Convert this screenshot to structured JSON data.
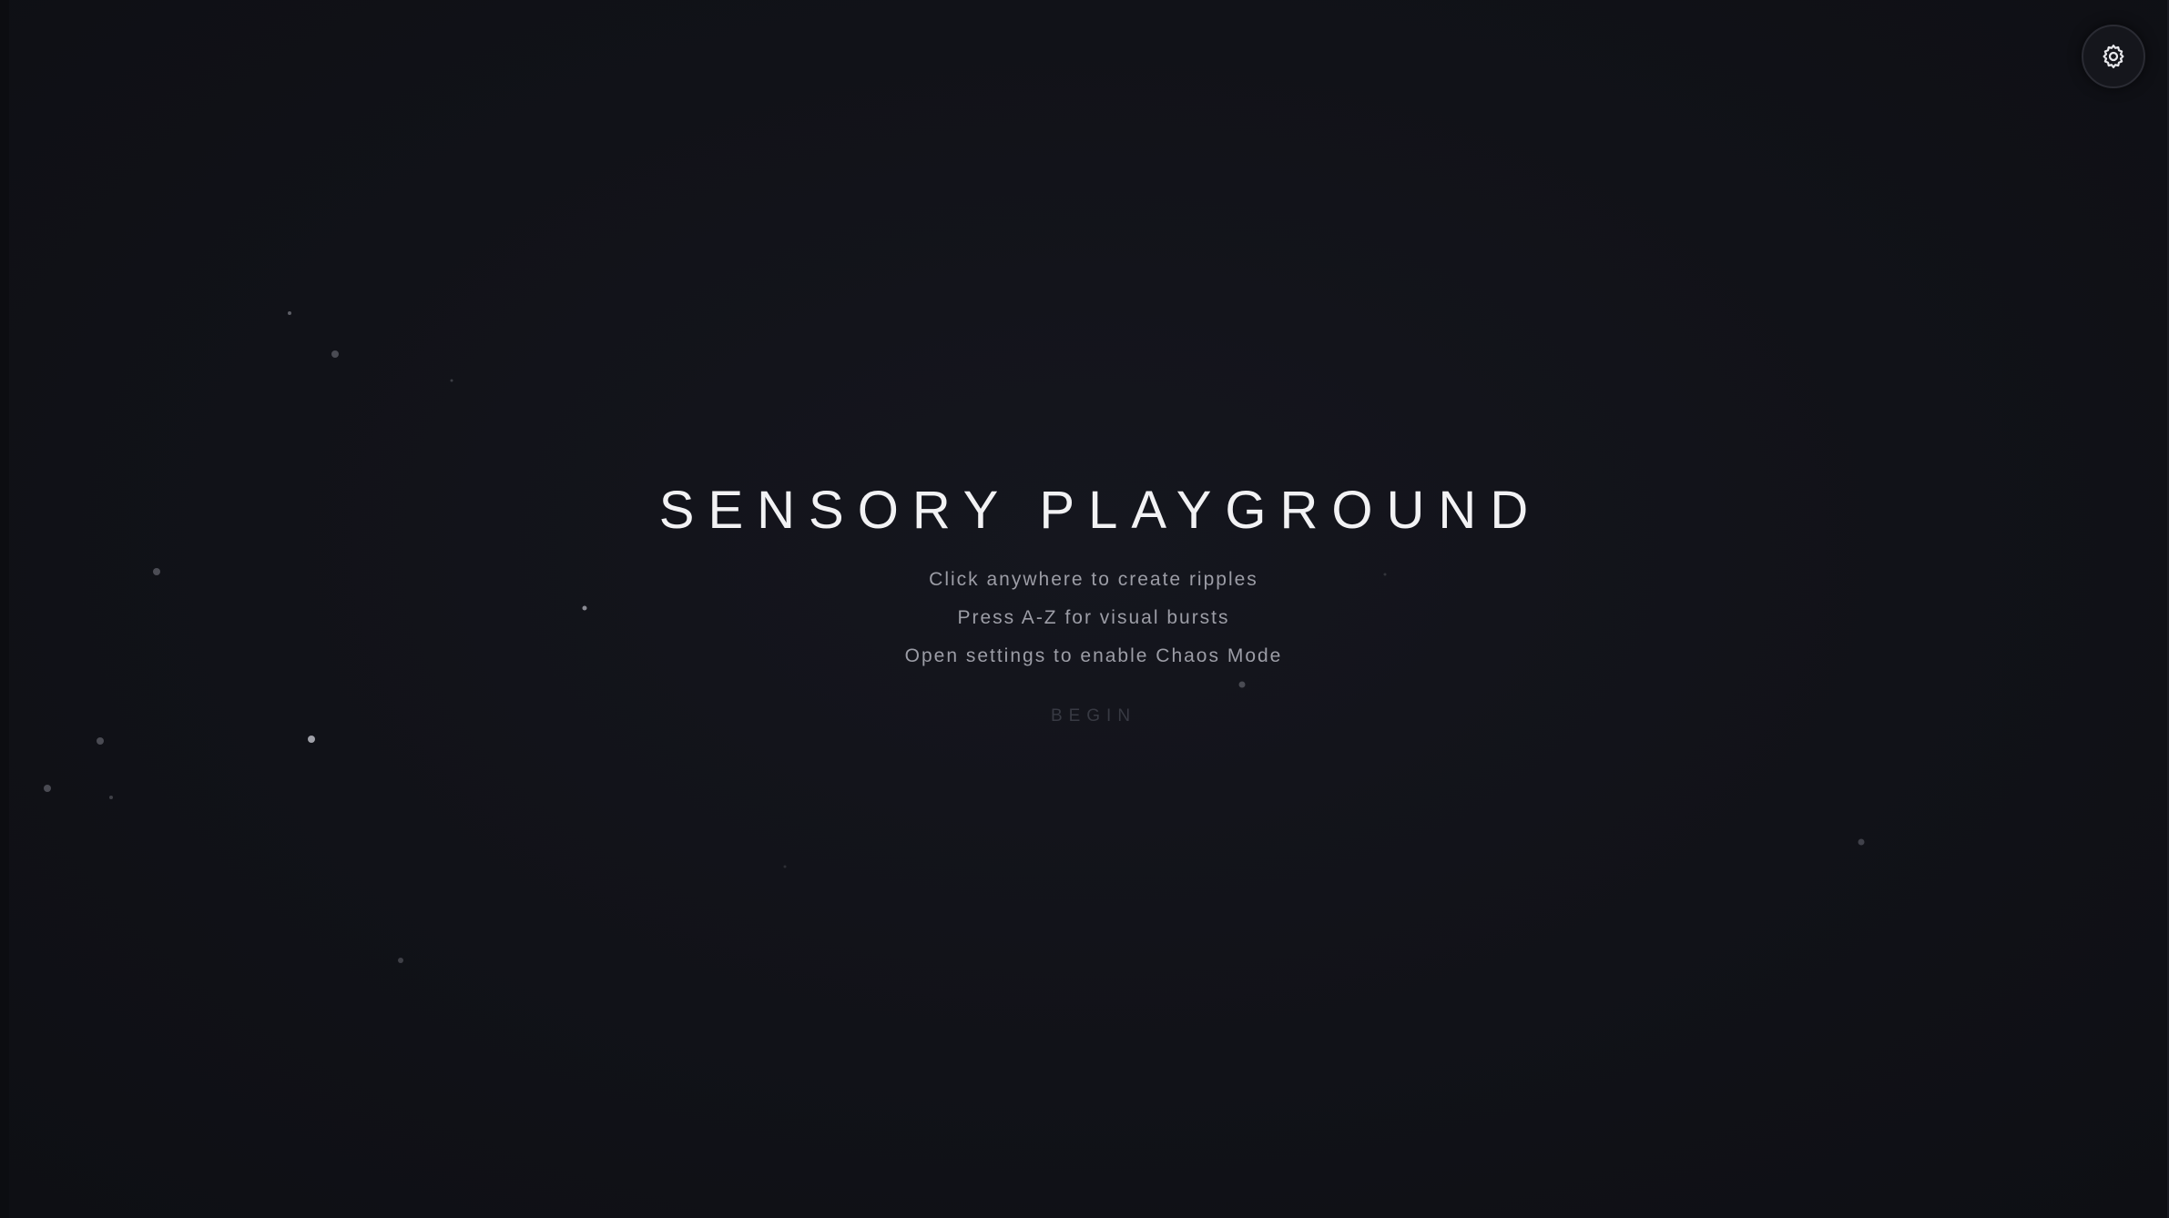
{
  "app": {
    "title": "SENSORY PLAYGROUND",
    "instructions": [
      "Click anywhere to create ripples",
      "Press A-Z for visual bursts",
      "Open settings to enable Chaos Mode"
    ],
    "begin_label": "BEGIN"
  },
  "settings_button": {
    "icon": "gear-icon"
  },
  "colors": {
    "background": "#111218",
    "title": "#f2f2f4",
    "instruction": "#9c9da6",
    "begin": "#383a43",
    "particle": "#6b6c74"
  }
}
